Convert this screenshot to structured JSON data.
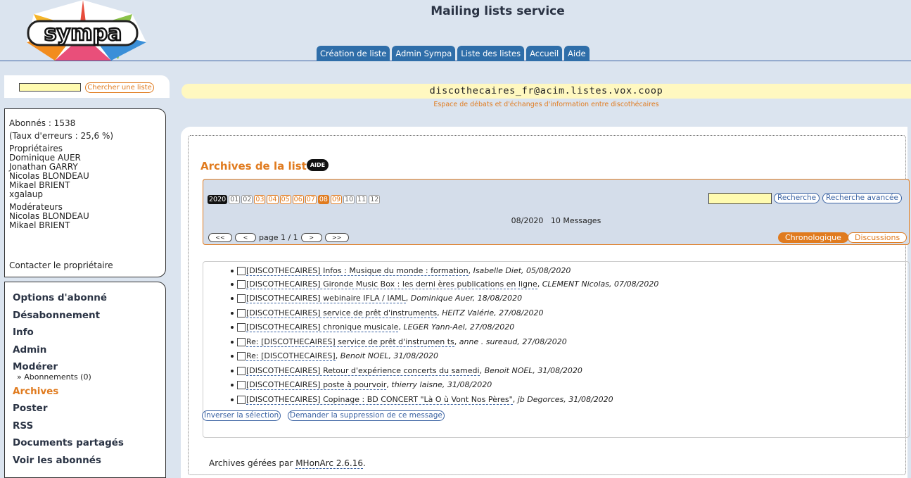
{
  "header": {
    "logo_text": "sympa",
    "title": "Mailing lists service",
    "tabs": [
      "Création de liste",
      "Admin Sympa",
      "Liste des listes",
      "Accueil",
      "Aide"
    ]
  },
  "sidebar": {
    "search_button": "Chercher une liste",
    "subscribers": "Abonnés : 1538",
    "error_rate": "(Taux d'erreurs : 25,6 %)",
    "owners_label": "Propriétaires",
    "owners": [
      "Dominique AUER",
      "Jonathan GARRY",
      "Nicolas BLONDEAU",
      "Mikael BRIENT",
      "xgalaup"
    ],
    "moderators_label": "Modérateurs",
    "moderators": [
      "Nicolas BLONDEAU",
      "Mikael BRIENT"
    ],
    "contact": "Contacter le propriétaire",
    "menu": {
      "options": "Options d'abonné",
      "unsubscribe": "Désabonnement",
      "info": "Info",
      "admin": "Admin",
      "moderate": "Modérer",
      "moderate_sub": "» Abonnements (0)",
      "archives": "Archives",
      "post": "Poster",
      "rss": "RSS",
      "shared": "Documents partagés",
      "subscribers": "Voir les abonnés"
    }
  },
  "list": {
    "address": "discothecaires_fr@acim.listes.vox.coop",
    "description": "Espace de débats et d'échanges d'information entre discothécaires"
  },
  "archives": {
    "title": "Archives de la liste",
    "help_badge": "AIDE",
    "year": "2020",
    "months": [
      "01",
      "02",
      "03",
      "04",
      "05",
      "06",
      "07",
      "08",
      "09",
      "10",
      "11",
      "12"
    ],
    "search_button": "Recherche",
    "advanced_search_button": "Recherche avancée",
    "period": "08/2020",
    "count": "10 Messages",
    "pager": {
      "first": "<<",
      "prev": "<",
      "label": "page 1 / 1",
      "next": ">",
      "last": ">>"
    },
    "sort_chrono": "Chronologique",
    "sort_threads": "Discussions",
    "messages": [
      {
        "subject": "[DISCOTHECAIRES] Infos : Musique du monde : formation",
        "author": "Isabelle Diet, 05/08/2020"
      },
      {
        "subject": "[DISCOTHECAIRES] Gironde Music Box : les derni ères publications en ligne",
        "author": "CLEMENT Nicolas, 07/08/2020"
      },
      {
        "subject": "[DISCOTHECAIRES] webinaire IFLA / IAML",
        "author": "Dominique Auer, 18/08/2020"
      },
      {
        "subject": "[DISCOTHECAIRES] service de prêt d'instruments",
        "author": "HEITZ Valérie, 27/08/2020"
      },
      {
        "subject": "[DISCOTHECAIRES] chronique musicale",
        "author": "LEGER Yann-Ael, 27/08/2020"
      },
      {
        "subject": "Re: [DISCOTHECAIRES] service de prêt d'instrumen ts",
        "author": "anne . sureaud, 27/08/2020"
      },
      {
        "subject": "Re: [DISCOTHECAIRES]",
        "author": "Benoit NOEL, 31/08/2020"
      },
      {
        "subject": "[DISCOTHECAIRES] Retour d'expérience concerts du samedi",
        "author": "Benoit NOEL, 31/08/2020"
      },
      {
        "subject": "[DISCOTHECAIRES] poste à pourvoir",
        "author": "thierry laisne, 31/08/2020"
      },
      {
        "subject": "[DISCOTHECAIRES] Copinage : BD CONCERT \"Là O ù Vont Nos Pères\"",
        "author": "jb Degorces, 31/08/2020"
      }
    ],
    "invert_button": "Inverser la sélection",
    "delete_button": "Demander la suppression de ce message",
    "footer_prefix": "Archives gérées par",
    "footer_link": "MHonArc 2.6.16",
    "footer_suffix": "."
  },
  "colors": {
    "accent": "#e07b1f",
    "link": "#3b63a3",
    "background": "#dbe4ef"
  }
}
